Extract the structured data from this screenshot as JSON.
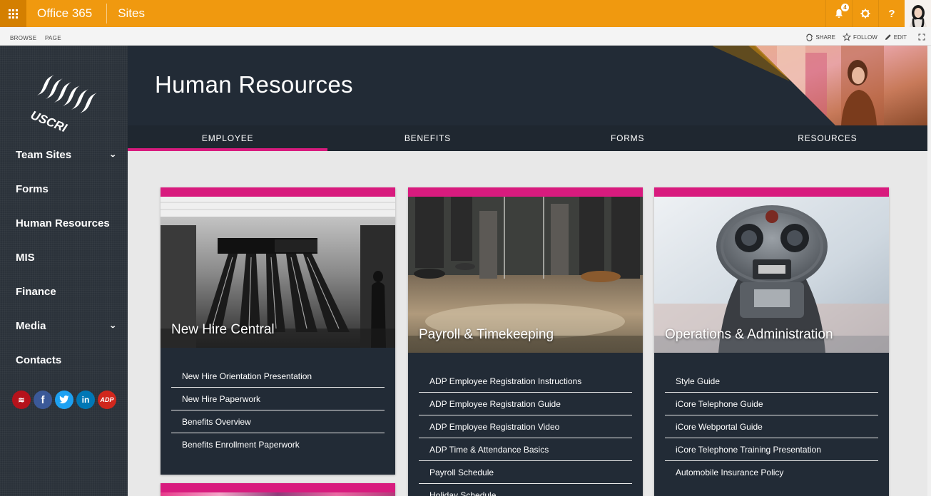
{
  "suitebar": {
    "brand": "Office 365",
    "section": "Sites",
    "notification_count": "4",
    "icons": [
      "app-launcher-icon",
      "bell-icon",
      "gear-icon",
      "help-icon",
      "user-avatar"
    ]
  },
  "ribbon": {
    "tabs": [
      "BROWSE",
      "PAGE"
    ],
    "actions": [
      "SHARE",
      "FOLLOW",
      "EDIT"
    ]
  },
  "leftnav": {
    "logo_text": "USCRI",
    "items": [
      {
        "label": "Team Sites",
        "has_submenu": true
      },
      {
        "label": "Forms",
        "has_submenu": false
      },
      {
        "label": "Human Resources",
        "has_submenu": false
      },
      {
        "label": "MIS",
        "has_submenu": false
      },
      {
        "label": "Finance",
        "has_submenu": false
      },
      {
        "label": "Media",
        "has_submenu": true
      },
      {
        "label": "Contacts",
        "has_submenu": false
      }
    ],
    "social": [
      {
        "name": "uscri",
        "glyph": "≋",
        "color": "#b5121b"
      },
      {
        "name": "facebook",
        "glyph": "f",
        "color": "#3b5998"
      },
      {
        "name": "twitter",
        "glyph": "t",
        "color": "#1da1f2"
      },
      {
        "name": "linkedin",
        "glyph": "in",
        "color": "#0077b5"
      },
      {
        "name": "adp",
        "glyph": "ADP",
        "color": "#d0271d"
      }
    ]
  },
  "hero": {
    "title": "Human Resources",
    "tabs": [
      {
        "label": "EMPLOYEE",
        "active": true
      },
      {
        "label": "BENEFITS",
        "active": false
      },
      {
        "label": "FORMS",
        "active": false
      },
      {
        "label": "RESOURCES",
        "active": false
      }
    ]
  },
  "cards": [
    {
      "title": "New Hire Central",
      "links": [
        "New Hire Orientation Presentation",
        "New Hire Paperwork",
        "Benefits Overview",
        "Benefits Enrollment Paperwork"
      ]
    },
    {
      "title": "Payroll & Timekeeping",
      "links": [
        "ADP Employee Registration Instructions",
        "ADP Employee Registration Guide",
        "ADP Employee Registration Video",
        "ADP Time & Attendance Basics",
        "Payroll Schedule",
        "Holiday Schedule"
      ]
    },
    {
      "title": "Operations & Administration",
      "links": [
        "Style Guide",
        "iCore Telephone Guide",
        "iCore Webportal Guide",
        "iCore Telephone Training Presentation",
        "Automobile Insurance Policy"
      ]
    }
  ],
  "colors": {
    "suitebar": "#f0990f",
    "accent": "#d81b7e",
    "dark": "#222b36"
  }
}
